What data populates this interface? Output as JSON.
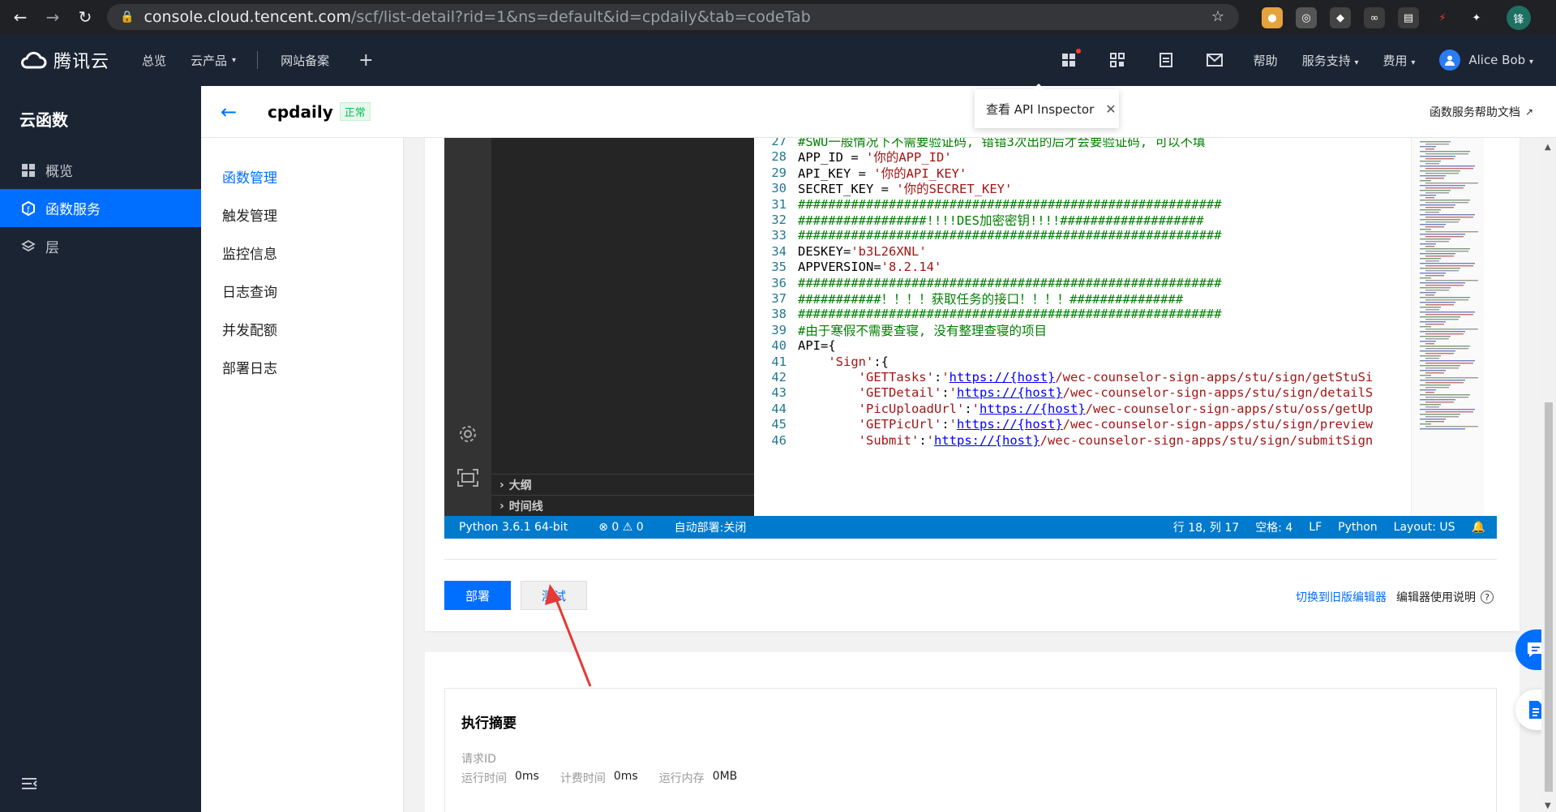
{
  "browser": {
    "url_host": "console.cloud.tencent.com",
    "url_path": "/scf/list-detail?rid=1&ns=default&id=cpdaily&tab=codeTab",
    "profile_initial": "锋"
  },
  "topnav": {
    "brand": "腾讯云",
    "items": [
      "总览",
      "云产品",
      "网站备案"
    ],
    "right_items": [
      "帮助",
      "服务支持",
      "费用"
    ],
    "user_name": "Alice Bob"
  },
  "sidebar": {
    "title": "云函数",
    "items": [
      {
        "label": "概览",
        "icon": "grid-icon"
      },
      {
        "label": "函数服务",
        "icon": "function-icon"
      },
      {
        "label": "层",
        "icon": "layers-icon"
      }
    ]
  },
  "submenu": {
    "items": [
      "函数管理",
      "触发管理",
      "监控信息",
      "日志查询",
      "并发配额",
      "部署日志"
    ],
    "active": "函数管理"
  },
  "header": {
    "title": "cpdaily",
    "status": "正常",
    "help_link": "函数服务帮助文档"
  },
  "tooltip": {
    "label": "查看 API Inspector"
  },
  "editor": {
    "explorer_sections": [
      "大纲",
      "时间线"
    ],
    "lines": [
      {
        "n": "27",
        "text": "#SWU一般情况下不需要验证码, 错错3次出的后才会要验证码, 可以不填"
      },
      {
        "n": "28",
        "text": "APP_ID = '你的APP_ID'"
      },
      {
        "n": "29",
        "text": "API_KEY = '你的API_KEY'"
      },
      {
        "n": "30",
        "text": "SECRET_KEY = '你的SECRET_KEY'"
      },
      {
        "n": "31",
        "text": "########################################################"
      },
      {
        "n": "32",
        "text": "#################!!!!DES加密密钥!!!!###################"
      },
      {
        "n": "33",
        "text": "########################################################"
      },
      {
        "n": "34",
        "text": "DESKEY='b3L26XNL'"
      },
      {
        "n": "35",
        "text": "APPVERSION='8.2.14'"
      },
      {
        "n": "36",
        "text": "########################################################"
      },
      {
        "n": "37",
        "text": "###########！！！！获取任务的接口！！！！###############"
      },
      {
        "n": "38",
        "text": "########################################################"
      },
      {
        "n": "39",
        "text": "#由于寒假不需要查寝, 没有整理查寝的项目"
      },
      {
        "n": "40",
        "text": "API={"
      },
      {
        "n": "41",
        "text": "    'Sign':{"
      },
      {
        "n": "42",
        "text": "        'GETTasks':'https://{host}/wec-counselor-sign-apps/stu/sign/getStuSi"
      },
      {
        "n": "43",
        "text": "        'GETDetail':'https://{host}/wec-counselor-sign-apps/stu/sign/detailS"
      },
      {
        "n": "44",
        "text": "        'PicUploadUrl':'https://{host}/wec-counselor-sign-apps/stu/oss/getUp"
      },
      {
        "n": "45",
        "text": "        'GETPicUrl':'https://{host}/wec-counselor-sign-apps/stu/sign/preview"
      },
      {
        "n": "46",
        "text": "        'Submit':'https://{host}/wec-counselor-sign-apps/stu/sign/submitSign"
      }
    ],
    "status_left": [
      "Python 3.6.1 64-bit",
      "⊗ 0 ⚠ 0",
      "自动部署:关闭"
    ],
    "status_right": [
      "行 18, 列 17",
      "空格: 4",
      "LF",
      "Python",
      "Layout: US"
    ]
  },
  "actions": {
    "deploy": "部署",
    "test": "测试",
    "switch_editor": "切换到旧版编辑器",
    "editor_help": "编辑器使用说明"
  },
  "execution": {
    "title": "执行摘要",
    "request_id_label": "请求ID",
    "metrics": [
      {
        "label": "运行时间",
        "value": "0ms"
      },
      {
        "label": "计费时间",
        "value": "0ms"
      },
      {
        "label": "运行内存",
        "value": "0MB"
      }
    ]
  },
  "colors": {
    "accent": "#006eff",
    "nav_bg": "#1b2433",
    "vscode_status": "#007acc",
    "annotation_arrow": "#e53935"
  }
}
